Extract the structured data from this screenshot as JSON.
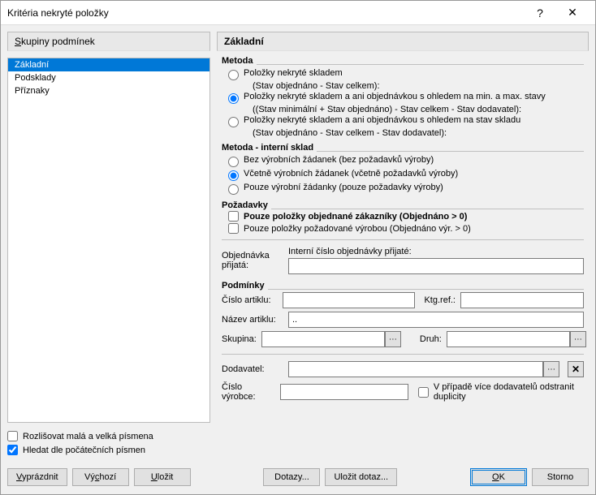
{
  "window": {
    "title": "Kritéria nekryté položky"
  },
  "left": {
    "header": "Skupiny podmínek",
    "items": [
      "Základní",
      "Podsklady",
      "Příznaky"
    ],
    "selected": 0,
    "case_sensitive_label": "Rozlišovat malá a velká písmena",
    "prefix_search_label": "Hledat dle počátečních písmen"
  },
  "right": {
    "header": "Základní"
  },
  "metoda": {
    "group": "Metoda",
    "opt1": "Položky nekryté skladem",
    "opt1_desc": "(Stav objednáno - Stav celkem):",
    "opt2": "Položky nekryté skladem a ani objednávkou s ohledem na min. a max. stavy",
    "opt2_desc": "((Stav minimální + Stav objednáno) - Stav celkem - Stav dodavatel):",
    "opt3": "Položky nekryté skladem a ani objednávkou s ohledem na stav skladu",
    "opt3_desc": "(Stav objednáno - Stav celkem - Stav dodavatel):"
  },
  "interni": {
    "group": "Metoda - interní sklad",
    "opt1": "Bez výrobních žádanek (bez požadavků výroby)",
    "opt2": "Včetně výrobních žádanek (včetně požadavků výroby)",
    "opt3": "Pouze výrobní žádanky (pouze požadavky výroby)"
  },
  "pozadavky": {
    "group": "Požadavky",
    "chk1": "Pouze položky objednané zákazníky (Objednáno > 0)",
    "chk2": "Pouze položky požadované výrobou (Objednáno výr. > 0)"
  },
  "objednavka": {
    "label": "Objednávka přijatá:",
    "field_label": "Interní číslo objednávky přijaté:",
    "value": ""
  },
  "podminky": {
    "group": "Podmínky",
    "cislo_artiklu_label": "Číslo artiklu:",
    "cislo_artiklu": "",
    "ktgref_label": "Ktg.ref.:",
    "ktgref": "",
    "nazev_artiklu_label": "Název artiklu:",
    "nazev_artiklu": "..",
    "skupina_label": "Skupina:",
    "skupina": "",
    "druh_label": "Druh:",
    "druh": ""
  },
  "dodavatel": {
    "label": "Dodavatel:",
    "value": "",
    "cislo_vyrobce_label": "Číslo výrobce:",
    "cislo_vyrobce": "",
    "dup_label": "V případě více dodavatelů odstranit duplicity"
  },
  "footer": {
    "clear": "Vyprázdnit",
    "default": "Výchozí",
    "save": "Uložit",
    "queries": "Dotazy...",
    "save_query": "Uložit dotaz...",
    "ok": "OK",
    "cancel": "Storno"
  }
}
